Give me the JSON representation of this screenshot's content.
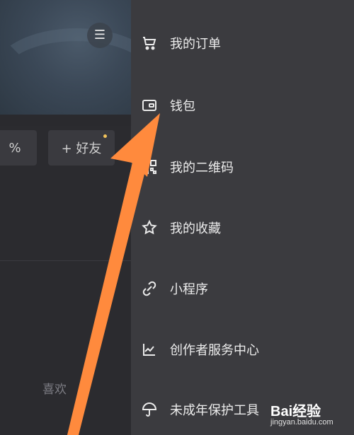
{
  "left_pane": {
    "percent_text": "%",
    "add_friend_label": "+ 好友",
    "likes_label": "喜欢"
  },
  "drawer": {
    "items": [
      {
        "label": "我的订单",
        "icon": "cart-icon"
      },
      {
        "label": "钱包",
        "icon": "wallet-icon"
      },
      {
        "label": "我的二维码",
        "icon": "qr-code-icon"
      },
      {
        "label": "我的收藏",
        "icon": "star-icon"
      },
      {
        "label": "小程序",
        "icon": "link-icon"
      },
      {
        "label": "创作者服务中心",
        "icon": "chart-line-icon"
      },
      {
        "label": "未成年保护工具",
        "icon": "umbrella-icon"
      }
    ]
  },
  "watermark": {
    "brand": "Bai经验",
    "url": "jingyan.baidu.com"
  },
  "colors": {
    "panel": "#3b3b3f",
    "left": "#2b2b2f",
    "arrow": "#ff8a3d",
    "accent_dot": "#f2c35a"
  }
}
